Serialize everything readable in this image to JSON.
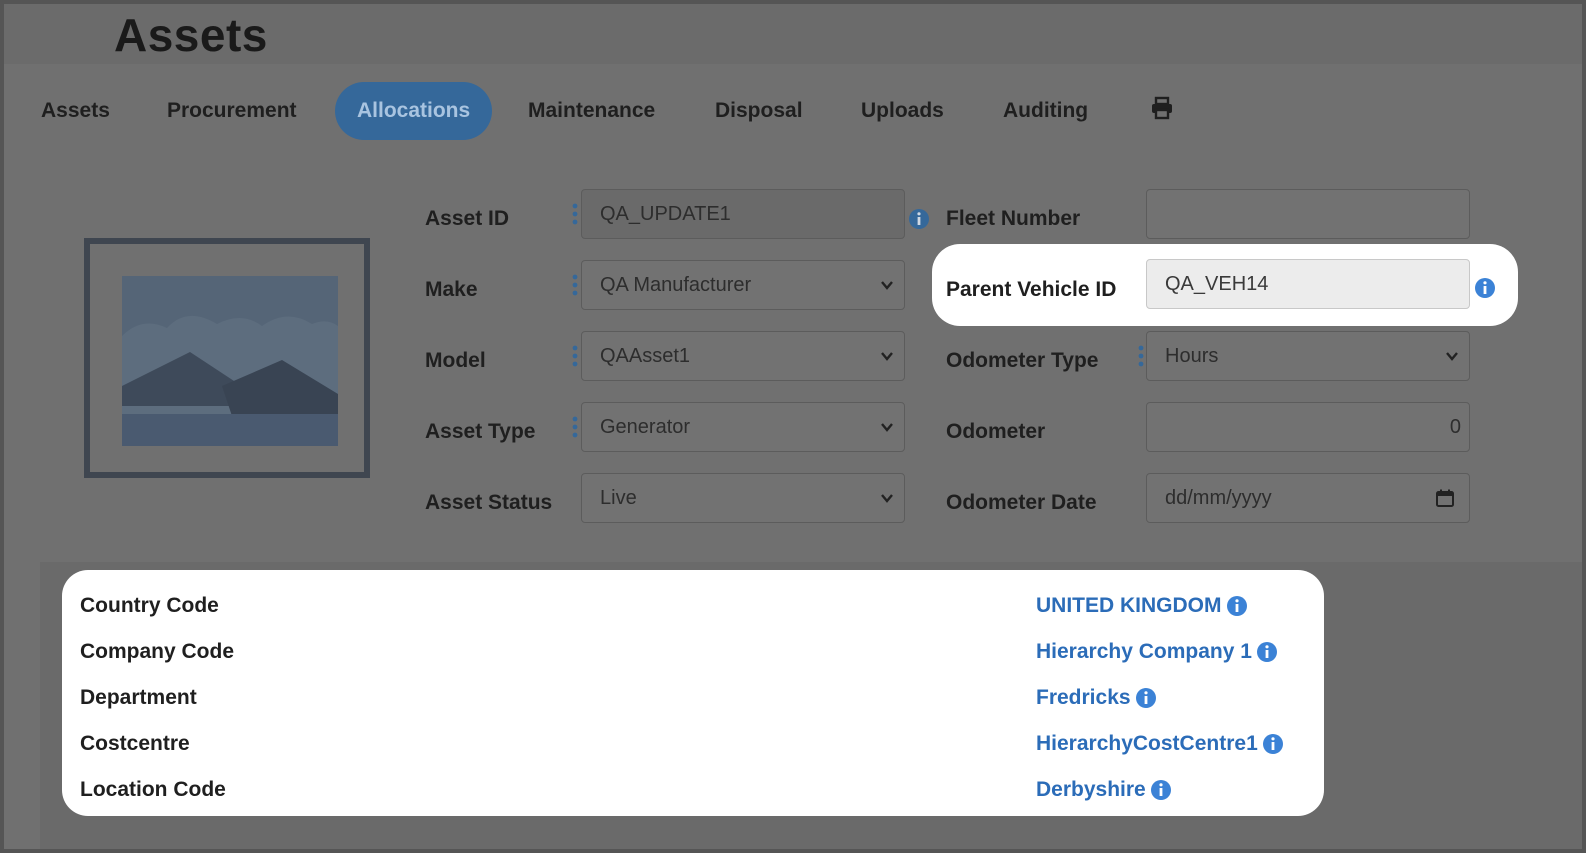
{
  "page": {
    "title": "Assets"
  },
  "tabs": [
    {
      "label": "Assets"
    },
    {
      "label": "Procurement"
    },
    {
      "label": "Allocations",
      "active": true
    },
    {
      "label": "Maintenance"
    },
    {
      "label": "Disposal"
    },
    {
      "label": "Uploads"
    },
    {
      "label": "Auditing"
    }
  ],
  "form": {
    "asset_id": {
      "label": "Asset ID",
      "value": "QA_UPDATE1"
    },
    "make": {
      "label": "Make",
      "value": "QA Manufacturer"
    },
    "model": {
      "label": "Model",
      "value": "QAAsset1"
    },
    "asset_type": {
      "label": "Asset Type",
      "value": "Generator"
    },
    "asset_status": {
      "label": "Asset Status",
      "value": "Live"
    },
    "fleet_number": {
      "label": "Fleet Number",
      "value": ""
    },
    "parent_vehicle_id": {
      "label": "Parent Vehicle ID",
      "value": "QA_VEH14"
    },
    "odometer_type": {
      "label": "Odometer Type",
      "value": "Hours"
    },
    "odometer": {
      "label": "Odometer",
      "value": "0"
    },
    "odometer_date": {
      "label": "Odometer Date",
      "placeholder": "dd/mm/yyyy"
    }
  },
  "hierarchy": [
    {
      "label": "Country Code",
      "value": "UNITED KINGDOM"
    },
    {
      "label": "Company Code",
      "value": "Hierarchy Company 1"
    },
    {
      "label": "Department",
      "value": "Fredricks"
    },
    {
      "label": "Costcentre",
      "value": "HierarchyCostCentre1"
    },
    {
      "label": "Location Code",
      "value": "Derbyshire"
    }
  ],
  "colors": {
    "accent": "#35689a",
    "link": "#2b6cb8",
    "info": "#3b82d6"
  },
  "icons": [
    "print-icon",
    "info-icon",
    "chevron-down-icon",
    "calendar-icon",
    "kebab-menu-icon",
    "image-placeholder-icon"
  ]
}
